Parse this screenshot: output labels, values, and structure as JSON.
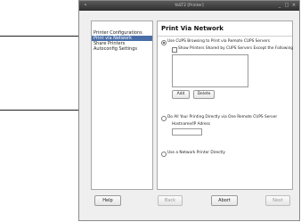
{
  "window": {
    "title": "YaST2 [Printer]"
  },
  "sidebar": {
    "items": [
      {
        "label": "Printer Configurations",
        "selected": false
      },
      {
        "label": "Print via Network",
        "selected": true
      },
      {
        "label": "Share Printers",
        "selected": false
      },
      {
        "label": "Autoconfig Settings",
        "selected": false
      }
    ]
  },
  "main": {
    "title": "Print Via Network",
    "option_browse_label": "Use CUPS Browsing to Print via Remote CUPS Servers",
    "option_browse_selected": true,
    "except_checkbox_label": "Show Printers Shared by CUPS Servers Except the Following",
    "except_checkbox_checked": false,
    "add_label": "Add",
    "delete_label": "Delete",
    "option_direct_label": "Do All Your Printing Directly via One Remote CUPS Server",
    "option_direct_selected": false,
    "hostname_label": "Hostname/IP Adress",
    "hostname_value": "",
    "option_network_printer_label": "Use a Network Printer Directly",
    "option_network_printer_selected": false
  },
  "footer": {
    "help_label": "Help",
    "back_label": "Back",
    "abort_label": "Abort",
    "next_label": "Next"
  },
  "colors": {
    "selection": "#4a6ea8",
    "titlebar": "#3a3a3a"
  }
}
